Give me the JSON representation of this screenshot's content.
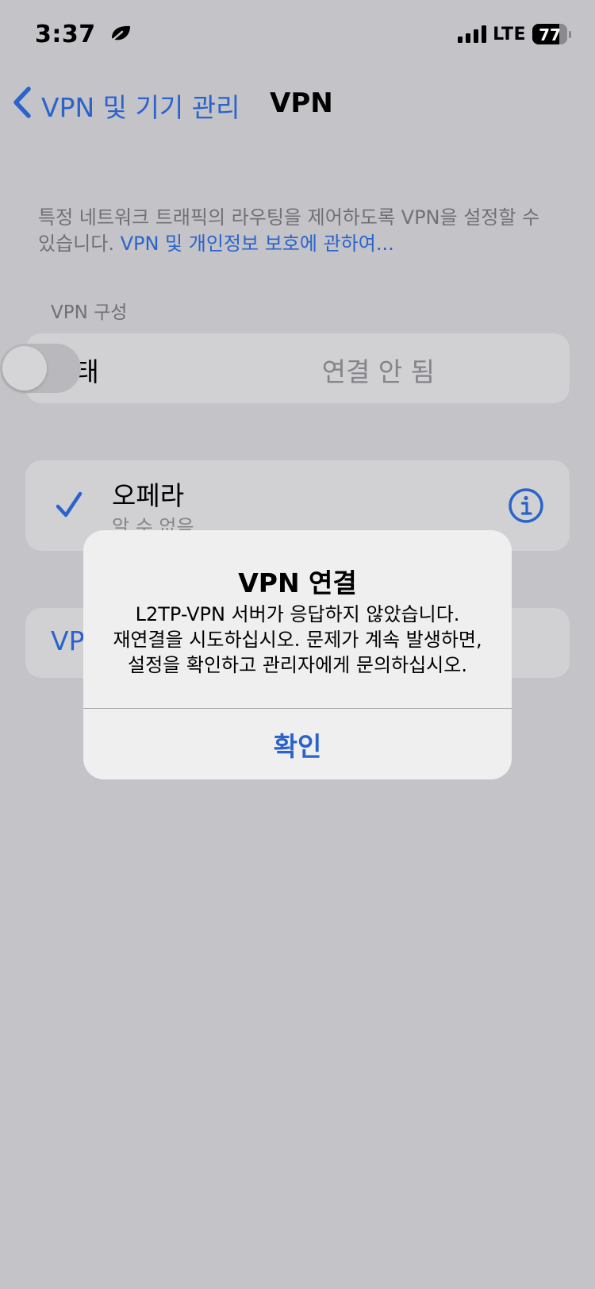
{
  "status_bar": {
    "time": "3:37",
    "network": "LTE",
    "battery": "77",
    "battery_level": 0.77,
    "focus_icon": "leaf-icon"
  },
  "nav": {
    "back_label": "VPN 및 기기 관리",
    "title": "VPN"
  },
  "description": {
    "text": "특정 네트워크 트래픽의 라우팅을 제어하도록 VPN을 설정할 수 있습니다. ",
    "link": "VPN 및 개인정보 보호에 관하여..."
  },
  "vpn_config": {
    "header": "VPN 구성",
    "status_label": "상태",
    "status_value": "연결 안 됨",
    "toggle_on": false
  },
  "vpn_list": [
    {
      "name": "오페라",
      "subtitle": "알 수 없음",
      "selected": true
    }
  ],
  "add_vpn": {
    "label": "VP"
  },
  "alert": {
    "title": "VPN 연결",
    "message_line1": "L2TP-VPN 서버가 응답하지 않았습니다.",
    "message_line2": "재연결을 시도하십시오. 문제가 계속 발생하면,",
    "message_line3": "설정을 확인하고 관리자에게 문의하십시오.",
    "ok_label": "확인"
  },
  "colors": {
    "accent": "#2a63cc",
    "background": "#c3c3c8",
    "card": "#d1d1d4",
    "alert": "#efeff0"
  }
}
